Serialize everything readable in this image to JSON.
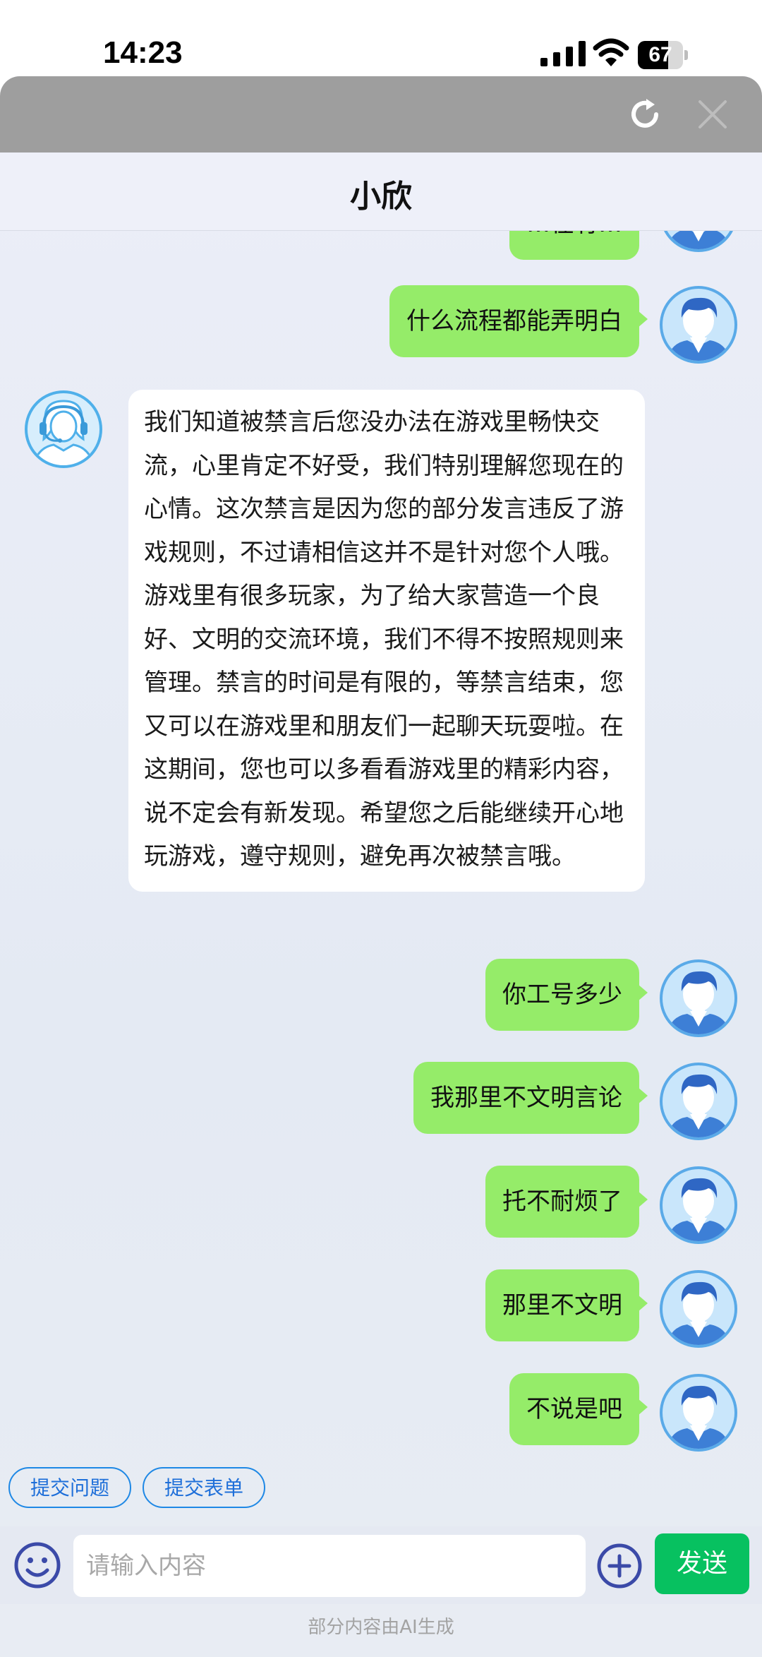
{
  "status_bar": {
    "time": "14:23",
    "battery": "67",
    "battery_level": 0.67
  },
  "header": {
    "title": "小欣"
  },
  "messages": [
    {
      "from": "user",
      "text": "…在有…"
    },
    {
      "from": "user",
      "text": "什么流程都能弄明白"
    },
    {
      "from": "bot",
      "text": "我们知道被禁言后您没办法在游戏里畅快交流，心里肯定不好受，我们特别理解您现在的心情。这次禁言是因为您的部分发言违反了游戏规则，不过请相信这并不是针对您个人哦。游戏里有很多玩家，为了给大家营造一个良好、文明的交流环境，我们不得不按照规则来管理。禁言的时间是有限的，等禁言结束，您又可以在游戏里和朋友们一起聊天玩耍啦。在这期间，您也可以多看看游戏里的精彩内容，说不定会有新发现。希望您之后能继续开心地玩游戏，遵守规则，避免再次被禁言哦。"
    },
    {
      "from": "user",
      "text": "你工号多少"
    },
    {
      "from": "user",
      "text": "我那里不文明言论"
    },
    {
      "from": "user",
      "text": "托不耐烦了"
    },
    {
      "from": "user",
      "text": "那里不文明"
    },
    {
      "from": "user",
      "text": "不说是吧"
    }
  ],
  "quick_actions": [
    "提交问题",
    "提交表单"
  ],
  "input": {
    "placeholder": "请输入内容",
    "send_label": "发送"
  },
  "footer": {
    "note": "部分内容由AI生成"
  },
  "colors": {
    "user_bubble": "#95ec69",
    "send_button": "#07c160",
    "topbar": "#9e9e9e",
    "accent": "#1e88e5"
  }
}
